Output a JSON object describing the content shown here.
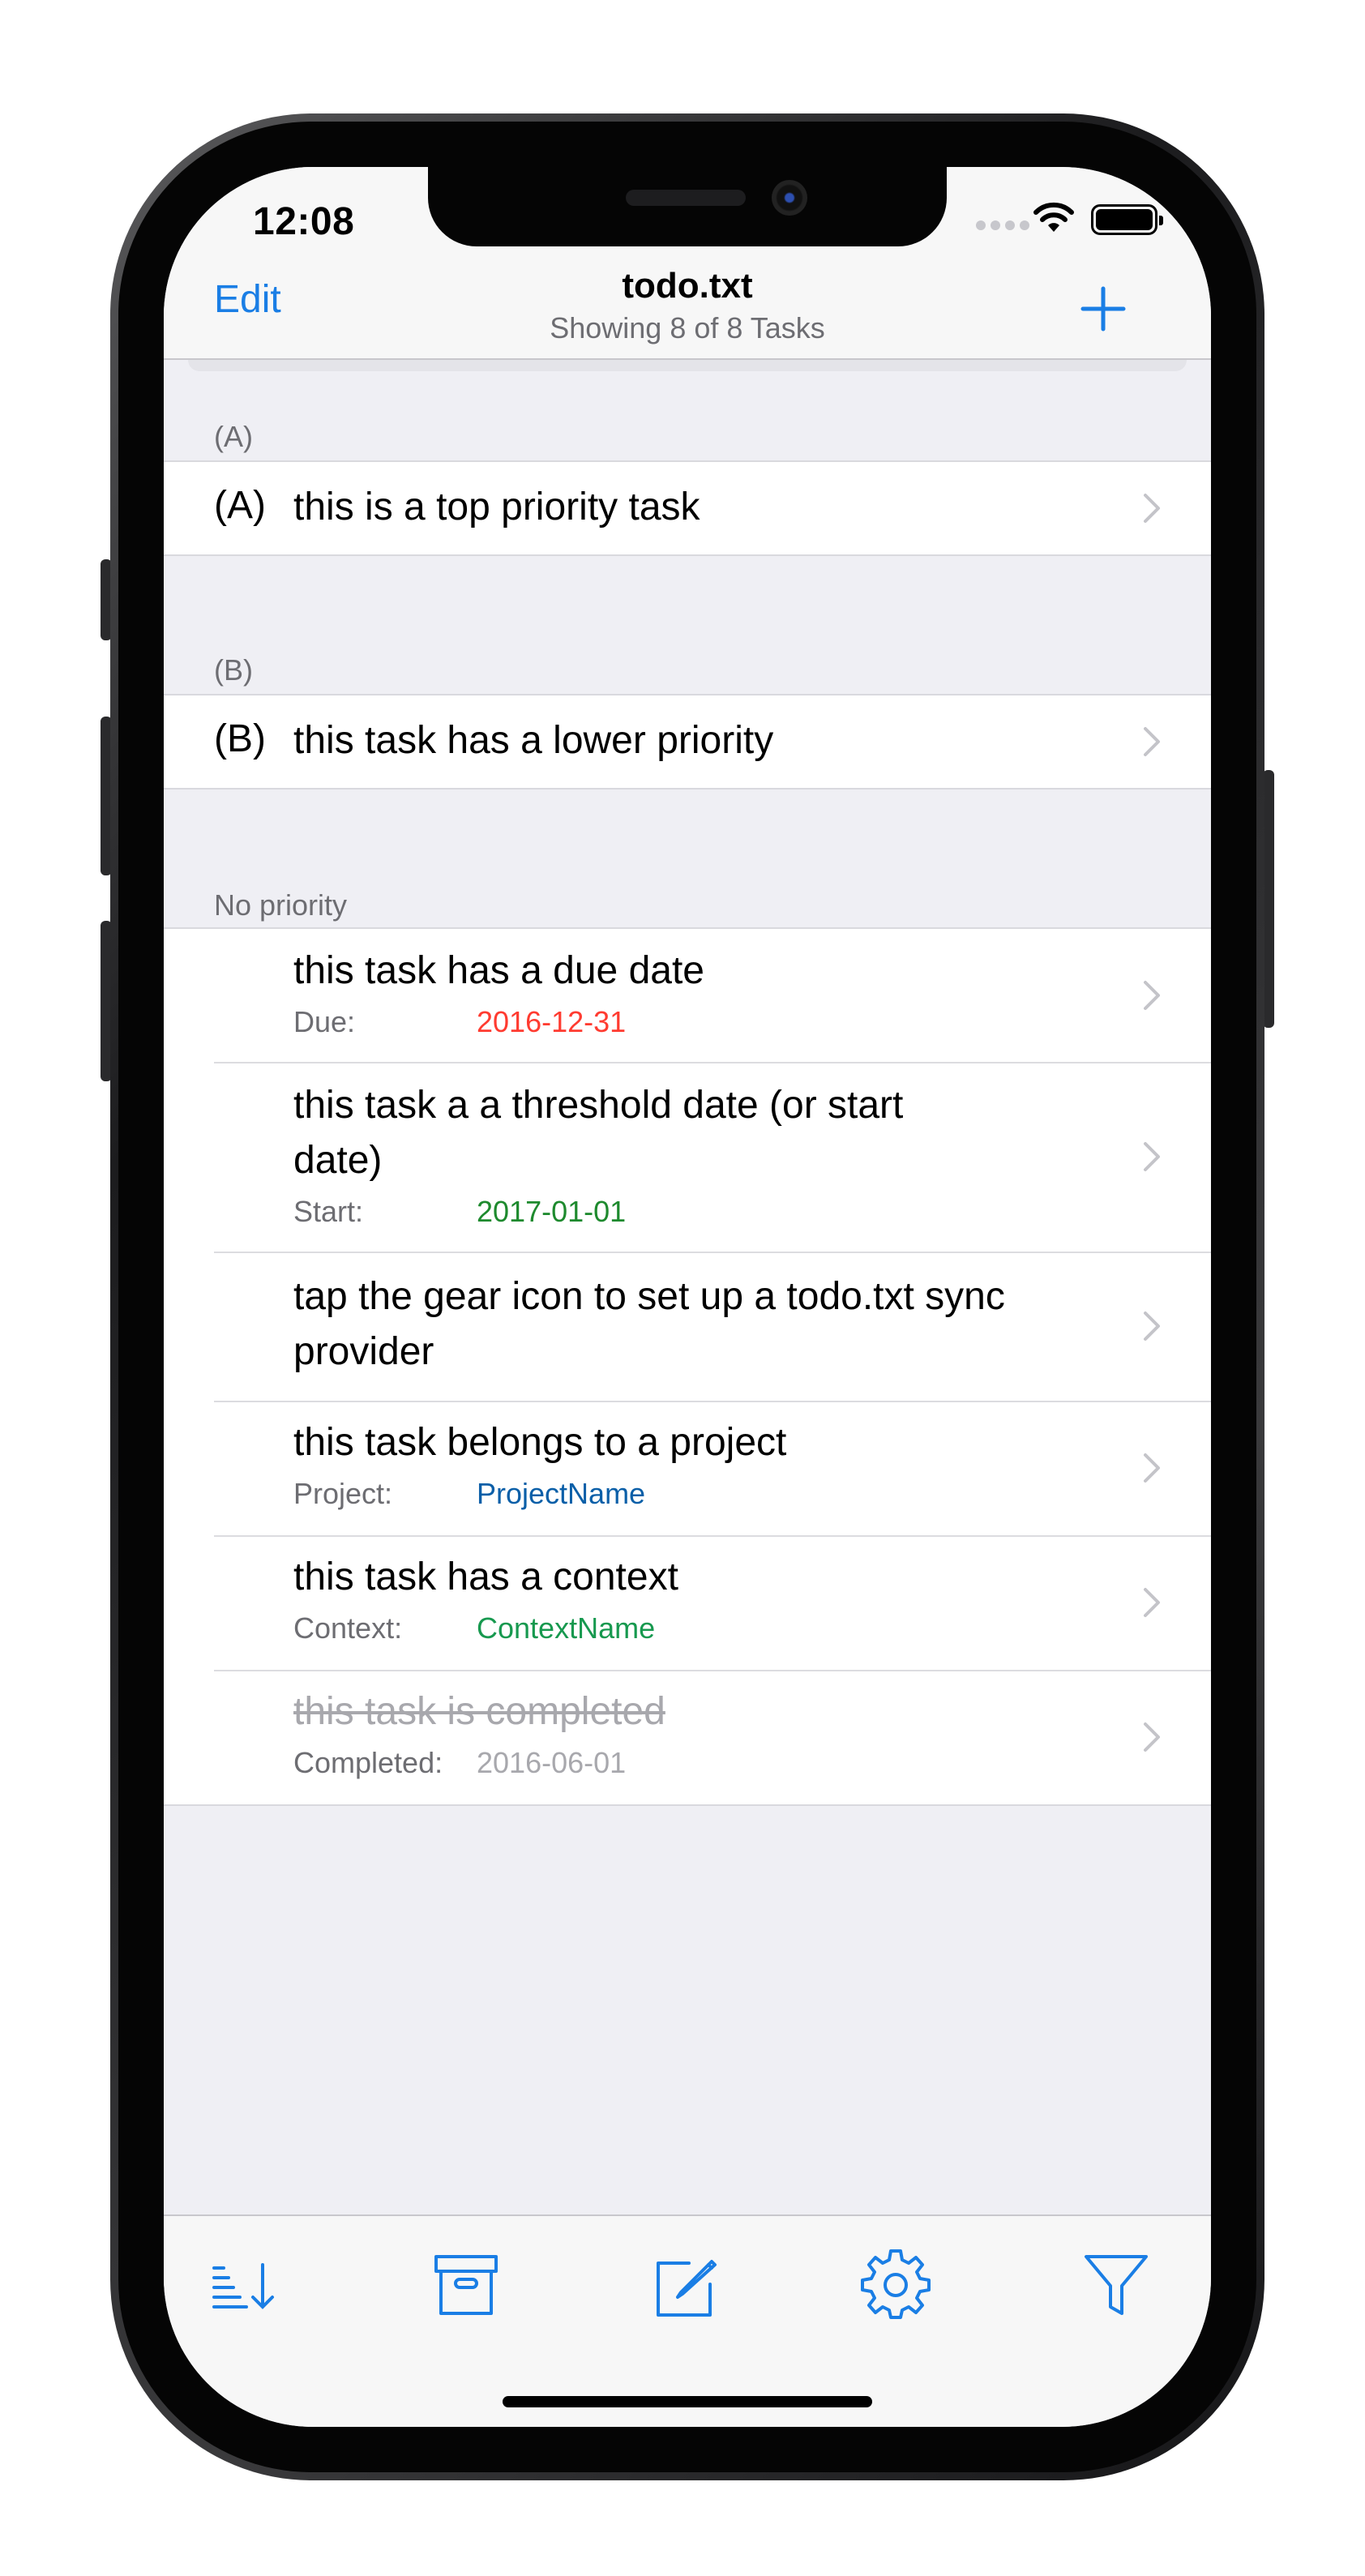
{
  "status_bar": {
    "time": "12:08"
  },
  "nav": {
    "edit_label": "Edit",
    "title": "todo.txt",
    "subtitle": "Showing 8 of 8 Tasks"
  },
  "sections": [
    {
      "header": "(A)",
      "tasks": [
        {
          "priority": "(A)",
          "text": "this is a top priority task"
        }
      ]
    },
    {
      "header": "(B)",
      "tasks": [
        {
          "priority": "(B)",
          "text": "this task has a lower priority"
        }
      ]
    },
    {
      "header": "No priority",
      "tasks": [
        {
          "text": "this task has a due date",
          "meta_label": "Due:",
          "meta_value": "2016-12-31"
        },
        {
          "text": "this task a a threshold date (or start date)",
          "meta_label": "Start:",
          "meta_value": "2017-01-01"
        },
        {
          "text": "tap the gear icon to set up a todo.txt sync provider"
        },
        {
          "text": "this task belongs to a project",
          "meta_label": "Project:",
          "meta_value": "ProjectName"
        },
        {
          "text": "this task has a context",
          "meta_label": "Context:",
          "meta_value": "ContextName"
        },
        {
          "text": "this task is completed",
          "meta_label": "Completed:",
          "meta_value": "2016-06-01",
          "completed": true
        }
      ]
    }
  ],
  "toolbar": {
    "icons": [
      "sort-icon",
      "archive-icon",
      "compose-icon",
      "gear-icon",
      "filter-icon"
    ]
  },
  "colors": {
    "accent": "#1a7ee5",
    "due": "#ff3b30",
    "start": "#1e8a2e",
    "project": "#0a5fa8",
    "context": "#17994f",
    "completed": "#a8a8ad"
  }
}
